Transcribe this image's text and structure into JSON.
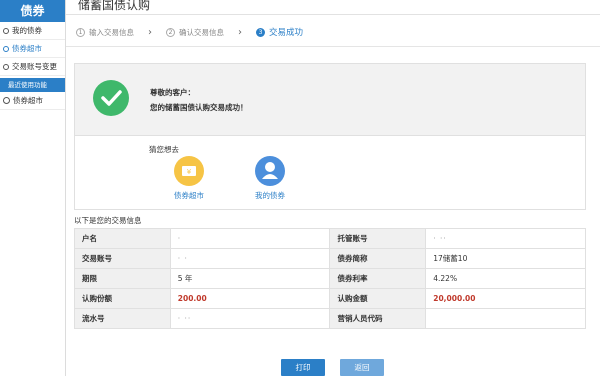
{
  "sidebar": {
    "header": "债券",
    "items": [
      {
        "label": "我的债券",
        "active": false
      },
      {
        "label": "债券超市",
        "active": true
      },
      {
        "label": "交易账号变更",
        "active": false
      }
    ],
    "section_label": "最近使用功能",
    "recent": [
      {
        "label": "债券超市"
      }
    ]
  },
  "page": {
    "title": "储蓄国债认购"
  },
  "steps": [
    {
      "num": "1",
      "label": "输入交易信息"
    },
    {
      "num": "2",
      "label": "确认交易信息"
    },
    {
      "num": "3",
      "label": "交易成功"
    }
  ],
  "success": {
    "greeting": "尊敬的客户：",
    "message": "您的储蓄国债认购交易成功！"
  },
  "guess": {
    "title": "猜您想去",
    "links": [
      {
        "label": "债券超市",
        "icon": "ticket-icon"
      },
      {
        "label": "我的债券",
        "icon": "user-icon"
      }
    ]
  },
  "info": {
    "caption": "以下是您的交易信息",
    "rows": [
      {
        "k1": "户名",
        "v1": "·",
        "k2": "托管账号",
        "v2": "· ··"
      },
      {
        "k1": "交易账号",
        "v1": "·   ·",
        "k2": "债券简称",
        "v2": "17储蓄10"
      },
      {
        "k1": "期限",
        "v1": "5 年",
        "k2": "债券利率",
        "v2": "4.22%"
      },
      {
        "k1": "认购份额",
        "v1": "200.00",
        "k2": "认购金额",
        "v2": "20,000.00"
      },
      {
        "k1": "流水号",
        "v1": "·        ··",
        "k2": "营销人员代码",
        "v2": ""
      }
    ]
  },
  "buttons": {
    "print": "打印",
    "back": "返回"
  },
  "colors": {
    "accent": "#2b7fc7",
    "success": "#3fb86b",
    "amount": "#c0392b"
  }
}
